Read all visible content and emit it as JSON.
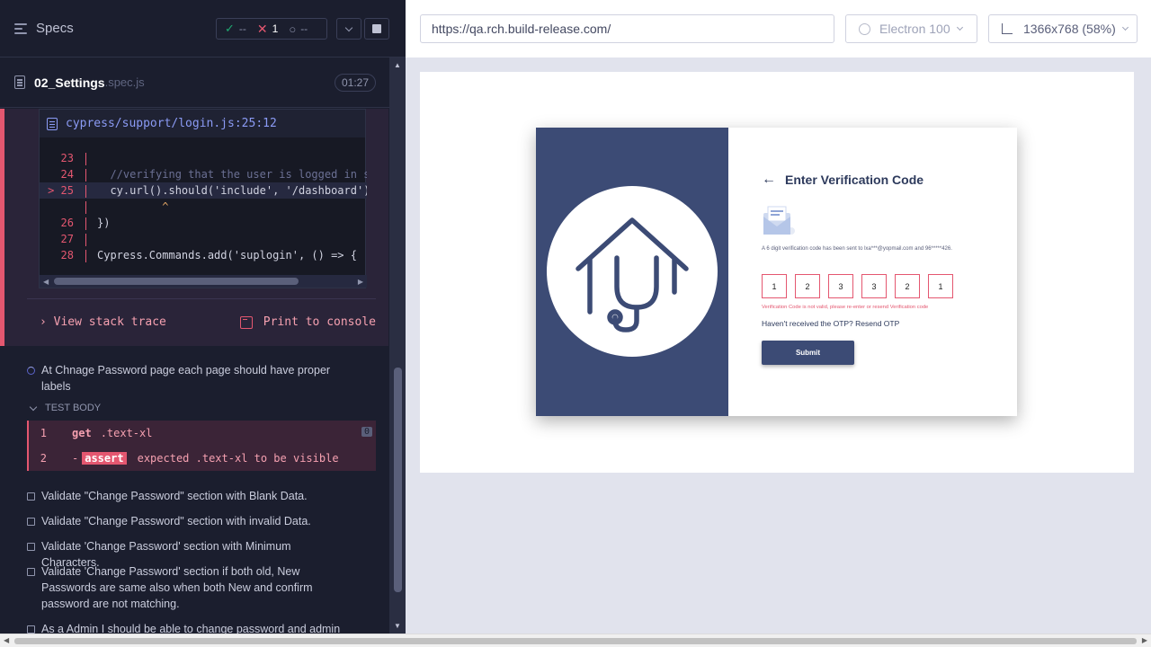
{
  "reporter": {
    "title": "Specs",
    "stats": {
      "passed": "--",
      "failed": "1",
      "pending": "--"
    },
    "spec": {
      "name": "02_Settings",
      "ext": ".spec.js",
      "duration": "01:27"
    },
    "error": {
      "file": "cypress/support/login.js:25:12",
      "lines": [
        {
          "num": "23",
          "code": ""
        },
        {
          "num": "24",
          "code": "  //verifying that the user is logged in su"
        },
        {
          "num": "> 25",
          "code": "  cy.url().should('include', '/dashboard');"
        },
        {
          "num": "",
          "code": "          ^"
        },
        {
          "num": "26",
          "code": "})"
        },
        {
          "num": "27",
          "code": ""
        },
        {
          "num": "28",
          "code": "Cypress.Commands.add('suplogin', () => {"
        }
      ],
      "view_stack_trace": "View stack trace",
      "print_to_console": "Print to console"
    },
    "running_test": "At Chnage Password page each page should have proper labels",
    "test_body_label": "TEST BODY",
    "commands": [
      {
        "num": "1",
        "name": "get",
        "message": ".text-xl",
        "badge": "0"
      },
      {
        "num": "2",
        "name": "assert",
        "message": "expected  .text-xl  to be  visible"
      }
    ],
    "tests": [
      "Validate \"Change Password\" section with Blank Data.",
      "Validate \"Change Password\" section with invalid Data.",
      "Validate 'Change Password' section with Minimum Characters.",
      "Validate 'Change Password' section if both old, New Passwords are same also when both New and confirm password are not matching.",
      "As a Admin I should be able to change password and admin"
    ]
  },
  "aut": {
    "url": "https://qa.rch.build-release.com/",
    "browser": "Electron 100",
    "viewport": "1366x768  (58%)",
    "page": {
      "title": "Enter Verification Code",
      "message": "A 6 digit verification code has been sent to lxa***@yopmail.com and 96*****426.",
      "otp": [
        "1",
        "2",
        "3",
        "3",
        "2",
        "1"
      ],
      "error": "Verification Code is not valid, please re-enter or resend Verification code",
      "resend": "Haven't received the OTP? Resend OTP",
      "submit": "Submit"
    }
  },
  "colors": {
    "fail": "#e45770",
    "pass": "#1fa971",
    "brand": "#3c4b75"
  }
}
